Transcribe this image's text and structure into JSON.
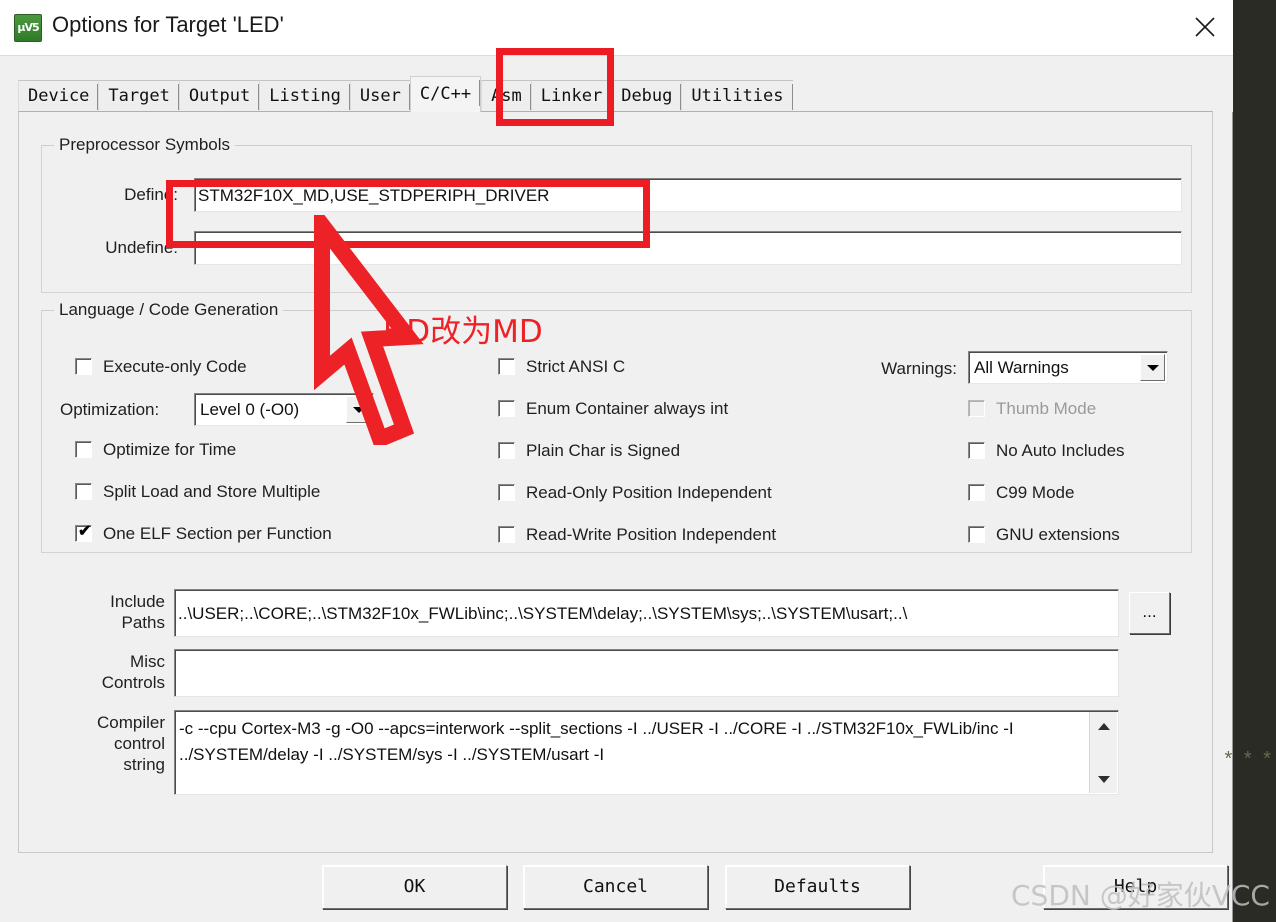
{
  "window": {
    "title": "Options for Target 'LED'",
    "icon": "keil-uvision-icon",
    "close_icon": "close-icon"
  },
  "tabs": [
    {
      "label": "Device",
      "selected": false
    },
    {
      "label": "Target",
      "selected": false
    },
    {
      "label": "Output",
      "selected": false
    },
    {
      "label": "Listing",
      "selected": false
    },
    {
      "label": "User",
      "selected": false
    },
    {
      "label": "C/C++",
      "selected": true
    },
    {
      "label": "Asm",
      "selected": false
    },
    {
      "label": "Linker",
      "selected": false
    },
    {
      "label": "Debug",
      "selected": false
    },
    {
      "label": "Utilities",
      "selected": false
    }
  ],
  "preprocessor": {
    "legend": "Preprocessor Symbols",
    "define_label": "Define:",
    "define_value": "STM32F10X_MD,USE_STDPERIPH_DRIVER",
    "undefine_label": "Undefine:",
    "undefine_value": ""
  },
  "language": {
    "legend": "Language / Code Generation",
    "optimization_label": "Optimization:",
    "optimization_value": "Level 0 (-O0)",
    "warnings_label": "Warnings:",
    "warnings_value": "All Warnings",
    "col1": [
      {
        "label": "Execute-only Code",
        "checked": false,
        "disabled": false
      },
      {
        "label": "Optimize for Time",
        "checked": false,
        "disabled": false
      },
      {
        "label": "Split Load and Store Multiple",
        "checked": false,
        "disabled": false
      },
      {
        "label": "One ELF Section per Function",
        "checked": true,
        "disabled": false
      }
    ],
    "col2": [
      {
        "label": "Strict ANSI C",
        "checked": false,
        "disabled": false
      },
      {
        "label": "Enum Container always int",
        "checked": false,
        "disabled": false
      },
      {
        "label": "Plain Char is Signed",
        "checked": false,
        "disabled": false
      },
      {
        "label": "Read-Only Position Independent",
        "checked": false,
        "disabled": false
      },
      {
        "label": "Read-Write Position Independent",
        "checked": false,
        "disabled": false
      }
    ],
    "col3": [
      {
        "label": "Thumb Mode",
        "checked": false,
        "disabled": true
      },
      {
        "label": "No Auto Includes",
        "checked": false,
        "disabled": false
      },
      {
        "label": "C99 Mode",
        "checked": false,
        "disabled": false
      },
      {
        "label": "GNU extensions",
        "checked": false,
        "disabled": false
      }
    ]
  },
  "paths": {
    "include_label": "Include\nPaths",
    "include_value": "..\\USER;..\\CORE;..\\STM32F10x_FWLib\\inc;..\\SYSTEM\\delay;..\\SYSTEM\\sys;..\\SYSTEM\\usart;..\\",
    "browse_label": "...",
    "misc_label": "Misc\nControls",
    "misc_value": "",
    "compiler_label": "Compiler\ncontrol\nstring",
    "compiler_value": "-c --cpu Cortex-M3 -g -O0 --apcs=interwork --split_sections -I ../USER -I ../CORE -I ../STM32F10x_FWLib/inc -I ../SYSTEM/delay -I ../SYSTEM/sys -I ../SYSTEM/usart -I"
  },
  "buttons": {
    "ok": "OK",
    "cancel": "Cancel",
    "defaults": "Defaults",
    "help": "Help"
  },
  "annotations": {
    "note_text": "HD改为MD",
    "accent_color": "#ed1c24",
    "highlight_tab": "C/C++",
    "highlight_field": "Define"
  },
  "watermark": {
    "text": "CSDN @好家伙VCC",
    "stars": "* * *"
  }
}
